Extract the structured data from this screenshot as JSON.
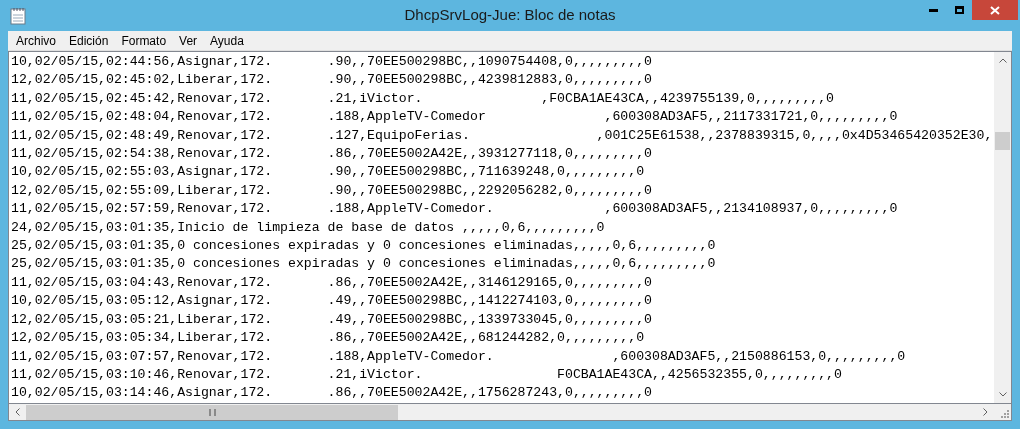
{
  "window": {
    "title": "DhcpSrvLog-Jue: Bloc de notas"
  },
  "menu": [
    "Archivo",
    "Edición",
    "Formato",
    "Ver",
    "Ayuda"
  ],
  "lines": [
    "10,02/05/15,02:44:56,Asignar,172.       .90,,70EE500298BC,,1090754408,0,,,,,,,,,0",
    "12,02/05/15,02:45:02,Liberar,172.       .90,,70EE500298BC,,4239812883,0,,,,,,,,,0",
    "11,02/05/15,02:45:42,Renovar,172.       .21,iVictor.               ,F0CBA1AE43CA,,4239755139,0,,,,,,,,,0",
    "11,02/05/15,02:48:04,Renovar,172.       .188,AppleTV-Comedor               ,600308AD3AF5,,2117331721,0,,,,,,,,,0",
    "11,02/05/15,02:48:49,Renovar,172.       .127,EquipoFerias.                ,001C25E61538,,2378839315,0,,,,0x4D53465420352E30,",
    "11,02/05/15,02:54:38,Renovar,172.       .86,,70EE5002A42E,,3931277118,0,,,,,,,,,0",
    "10,02/05/15,02:55:03,Asignar,172.       .90,,70EE500298BC,,711639248,0,,,,,,,,,0",
    "12,02/05/15,02:55:09,Liberar,172.       .90,,70EE500298BC,,2292056282,0,,,,,,,,,0",
    "11,02/05/15,02:57:59,Renovar,172.       .188,AppleTV-Comedor.              ,600308AD3AF5,,2134108937,0,,,,,,,,,0",
    "24,02/05/15,03:01:35,Inicio de limpieza de base de datos ,,,,,0,6,,,,,,,,,0",
    "25,02/05/15,03:01:35,0 concesiones expiradas y 0 concesiones eliminadas,,,,,0,6,,,,,,,,,0",
    "25,02/05/15,03:01:35,0 concesiones expiradas y 0 concesiones eliminadas,,,,,0,6,,,,,,,,,0",
    "11,02/05/15,03:04:43,Renovar,172.       .86,,70EE5002A42E,,3146129165,0,,,,,,,,,0",
    "10,02/05/15,03:05:12,Asignar,172.       .49,,70EE500298BC,,1412274103,0,,,,,,,,,0",
    "12,02/05/15,03:05:21,Liberar,172.       .49,,70EE500298BC,,1339733045,0,,,,,,,,,0",
    "12,02/05/15,03:05:34,Liberar,172.       .86,,70EE5002A42E,,681244282,0,,,,,,,,,0",
    "11,02/05/15,03:07:57,Renovar,172.       .188,AppleTV-Comedor.               ,600308AD3AF5,,2150886153,0,,,,,,,,,0",
    "11,02/05/15,03:10:46,Renovar,172.       .21,iVictor.                 F0CBA1AE43CA,,4256532355,0,,,,,,,,,0",
    "10,02/05/15,03:14:46,Asignar,172.       .86,,70EE5002A42E,,1756287243,0,,,,,,,,,0"
  ]
}
